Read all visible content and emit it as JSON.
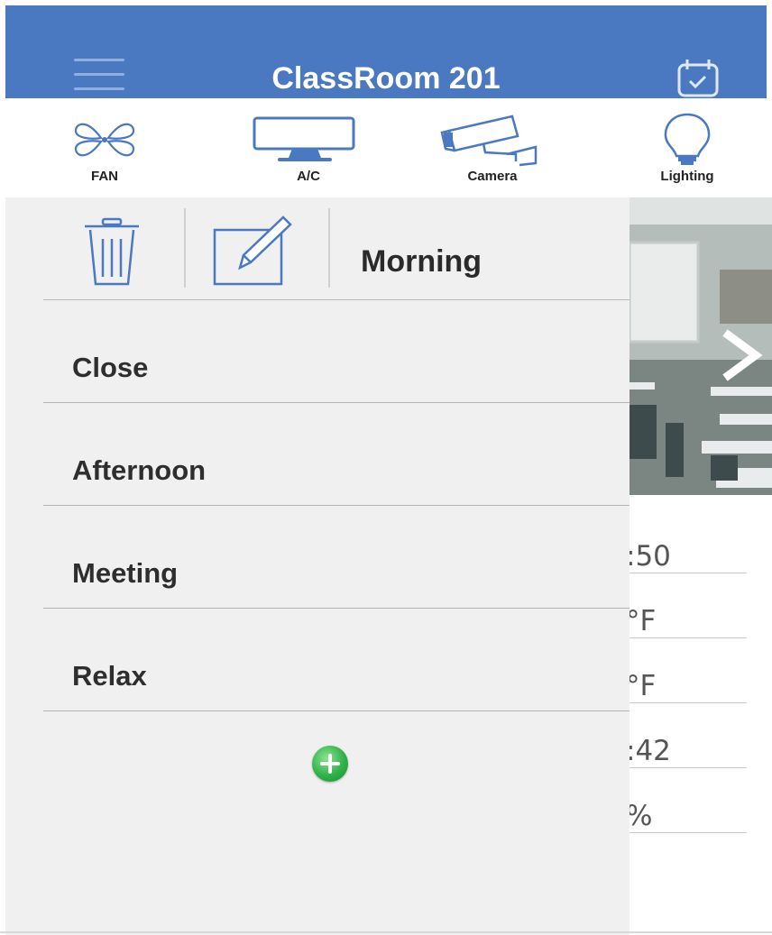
{
  "header": {
    "title": "ClassRoom 201"
  },
  "devices": [
    {
      "label": "FAN",
      "icon": "fan-icon"
    },
    {
      "label": "A/C",
      "icon": "ac-icon"
    },
    {
      "label": "Camera",
      "icon": "camera-icon"
    },
    {
      "label": "Lighting",
      "icon": "lightbulb-icon"
    }
  ],
  "drawer": {
    "current_scene": "Morning",
    "scenes": [
      "Close",
      "Afternoon",
      "Meeting",
      "Relax"
    ]
  },
  "readings": [
    ":50",
    "°F",
    "°F",
    ":42",
    "%"
  ],
  "colors": {
    "header": "#4a78c1",
    "icon_blue": "#4a78c1",
    "add_green": "#2fb24a",
    "drawer_bg": "#f0f0f0"
  }
}
